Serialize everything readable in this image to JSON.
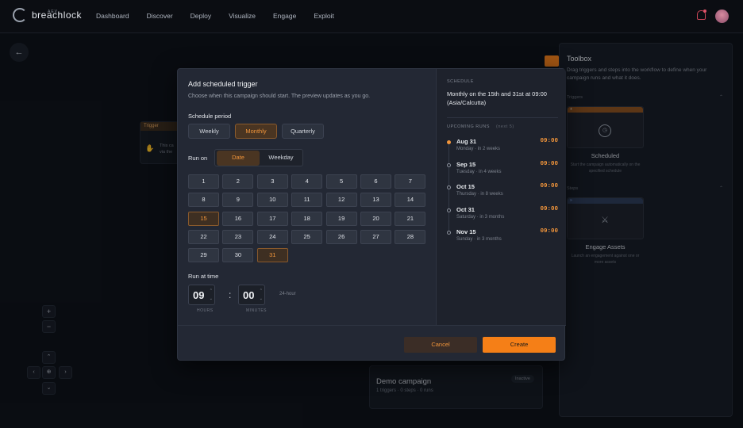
{
  "nav": {
    "logo": "breachlock",
    "logo_sub": "AEV",
    "links": [
      "Dashboard",
      "Discover",
      "Deploy",
      "Visualize",
      "Engage",
      "Exploit"
    ]
  },
  "background": {
    "trigger_node": {
      "tag": "Trigger",
      "text": "This ca via the"
    },
    "demo": {
      "title": "Demo campaign",
      "subtitle": "1 triggers · 0 steps · 0 runs",
      "badge": "Inactive"
    }
  },
  "toolbox": {
    "title": "Toolbox",
    "description": "Drag triggers and steps into the workflow to define when your campaign runs and what it does.",
    "triggers_label": "Triggers",
    "steps_label": "Steps",
    "scheduled": {
      "label": "Scheduled",
      "desc": "Start the campaign automatically on the specified schedule"
    },
    "engage": {
      "label": "Engage Assets",
      "desc": "Launch an engagement against one or more assets"
    }
  },
  "modal": {
    "title": "Add scheduled trigger",
    "subtitle": "Choose when this campaign should start. The preview updates as you go.",
    "period_label": "Schedule period",
    "periods": [
      "Weekly",
      "Monthly",
      "Quarterly"
    ],
    "selected_period": "Monthly",
    "run_on_label": "Run on",
    "run_on_options": [
      "Date",
      "Weekday"
    ],
    "days": [
      "1",
      "2",
      "3",
      "4",
      "5",
      "6",
      "7",
      "8",
      "9",
      "10",
      "11",
      "12",
      "13",
      "14",
      "15",
      "16",
      "17",
      "18",
      "19",
      "20",
      "21",
      "22",
      "23",
      "24",
      "25",
      "26",
      "27",
      "28",
      "29",
      "30",
      "31"
    ],
    "selected_days": [
      "15",
      "31"
    ],
    "time_label": "Run at time",
    "hours": "09",
    "minutes": "00",
    "hours_cap": "HOURS",
    "minutes_cap": "MINUTES",
    "clock": "24-hour",
    "cancel": "Cancel",
    "create": "Create",
    "schedule_cap": "SCHEDULE",
    "schedule_text": "Monthly on the 15th and 31st at 09:00 (Asia/Calcutta)",
    "upcoming_cap": "UPCOMING RUNS",
    "upcoming_count": "(next 5)",
    "runs": [
      {
        "date": "Aug 31",
        "sub": "Monday · in 2 weeks",
        "time": "09:00"
      },
      {
        "date": "Sep 15",
        "sub": "Tuesday · in 4 weeks",
        "time": "09:00"
      },
      {
        "date": "Oct 15",
        "sub": "Thursday · in 8 weeks",
        "time": "09:00"
      },
      {
        "date": "Oct 31",
        "sub": "Saturday · in 3 months",
        "time": "09:00"
      },
      {
        "date": "Nov 15",
        "sub": "Sunday · in 3 months",
        "time": "09:00"
      }
    ]
  },
  "colors": {
    "accent": "#f57f17",
    "bg": "#0c0f15",
    "modal": "#232834"
  }
}
